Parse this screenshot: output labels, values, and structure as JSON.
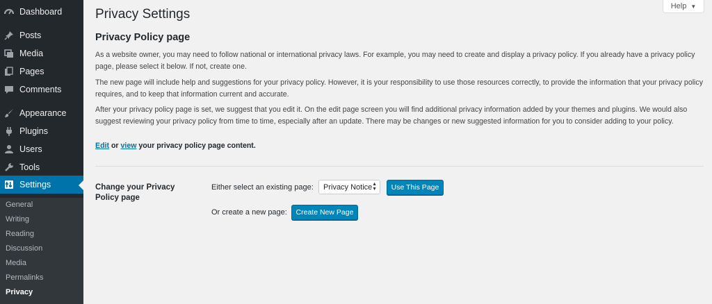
{
  "sidebar": {
    "items": [
      {
        "label": "Dashboard",
        "icon": "dashboard-icon"
      },
      {
        "label": "Posts",
        "icon": "pushpin-icon"
      },
      {
        "label": "Media",
        "icon": "media-icon"
      },
      {
        "label": "Pages",
        "icon": "pages-icon"
      },
      {
        "label": "Comments",
        "icon": "comment-icon"
      },
      {
        "label": "Appearance",
        "icon": "paintbrush-icon"
      },
      {
        "label": "Plugins",
        "icon": "plugin-icon"
      },
      {
        "label": "Users",
        "icon": "users-icon"
      },
      {
        "label": "Tools",
        "icon": "wrench-icon"
      },
      {
        "label": "Settings",
        "icon": "settings-icon"
      }
    ],
    "submenu": [
      "General",
      "Writing",
      "Reading",
      "Discussion",
      "Media",
      "Permalinks",
      "Privacy"
    ],
    "current_submenu": "Privacy"
  },
  "help": {
    "label": "Help"
  },
  "page": {
    "title": "Privacy Settings",
    "section_title": "Privacy Policy page",
    "paragraphs": [
      "As a website owner, you may need to follow national or international privacy laws. For example, you may need to create and display a privacy policy. If you already have a privacy policy page, please select it below. If not, create one.",
      "The new page will include help and suggestions for your privacy policy. However, it is your responsibility to use those resources correctly, to provide the information that your privacy policy requires, and to keep that information current and accurate.",
      "After your privacy policy page is set, we suggest that you edit it. On the edit page screen you will find additional privacy information added by your themes and plugins. We would also suggest reviewing your privacy policy from time to time, especially after an update. There may be changes or new suggested information for you to consider adding to your policy."
    ],
    "edit_link": "Edit",
    "or_text": " or ",
    "view_link": "view",
    "edit_suffix": " your privacy policy page content."
  },
  "form": {
    "field_label": "Change your Privacy Policy page",
    "select_label": "Either select an existing page:",
    "select_value": "Privacy Notice",
    "use_button": "Use This Page",
    "create_label": "Or create a new page:",
    "create_button": "Create New Page"
  },
  "colors": {
    "accent": "#0073aa",
    "sidebar_bg": "#23282d",
    "button_bg": "#0085ba"
  }
}
